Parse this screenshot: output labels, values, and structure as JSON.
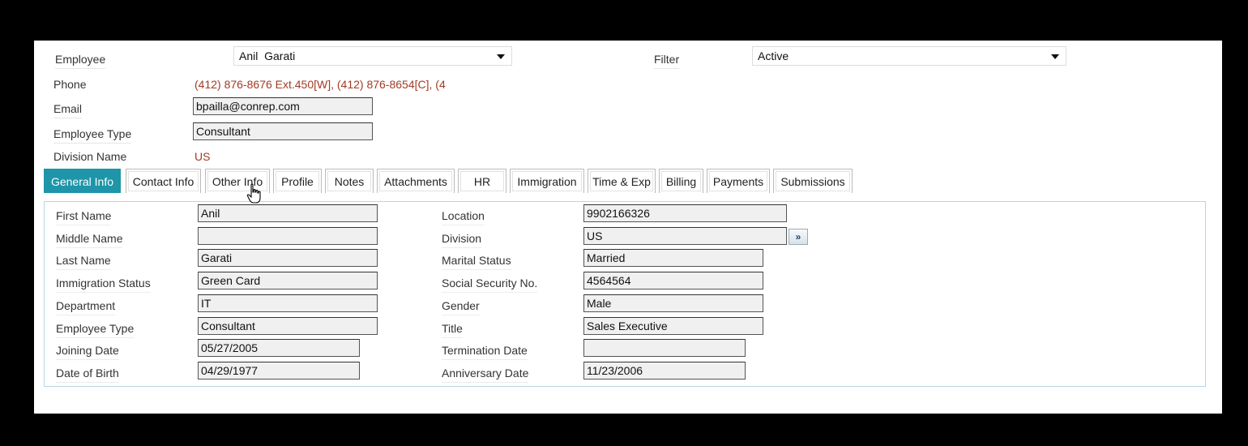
{
  "header": {
    "employee_label": "Employee",
    "employee_value": "Anil  Garati",
    "filter_label": "Filter",
    "filter_value": "Active",
    "phone_label": "Phone",
    "phone_value": "(412) 876-8676 Ext.450[W], (412) 876-8654[C], (4",
    "email_label": "Email",
    "email_value": "bpailla@conrep.com",
    "employee_type_label": "Employee Type",
    "employee_type_value": "Consultant",
    "division_label": "Division Name",
    "division_value": "US"
  },
  "tabs": [
    {
      "label": "General Info",
      "active": true
    },
    {
      "label": "Contact Info"
    },
    {
      "label": "Other Info"
    },
    {
      "label": "Profile"
    },
    {
      "label": "Notes"
    },
    {
      "label": "Attachments"
    },
    {
      "label": "HR"
    },
    {
      "label": "Immigration"
    },
    {
      "label": "Time & Exp"
    },
    {
      "label": "Billing"
    },
    {
      "label": "Payments"
    },
    {
      "label": "Submissions"
    }
  ],
  "general_info": {
    "left": [
      {
        "label": "First Name",
        "value": "Anil"
      },
      {
        "label": "Middle Name",
        "value": ""
      },
      {
        "label": "Last Name",
        "value": "Garati"
      },
      {
        "label": "Immigration Status",
        "value": "Green Card"
      },
      {
        "label": "Department",
        "value": "IT"
      },
      {
        "label": "Employee Type",
        "value": "Consultant"
      },
      {
        "label": "Joining Date",
        "value": "05/27/2005"
      },
      {
        "label": "Date of Birth",
        "value": "04/29/1977"
      }
    ],
    "right": [
      {
        "label": "Location",
        "value": "9902166326"
      },
      {
        "label": "Division",
        "value": "US"
      },
      {
        "label": "Marital Status",
        "value": "Married"
      },
      {
        "label": "Social Security No.",
        "value": "4564564"
      },
      {
        "label": "Gender",
        "value": "Male"
      },
      {
        "label": "Title",
        "value": "Sales Executive"
      },
      {
        "label": "Termination Date",
        "value": ""
      },
      {
        "label": "Anniversary Date",
        "value": "11/23/2006"
      }
    ],
    "division_more_label": "»"
  },
  "colors": {
    "active_tab": "#1e95a8",
    "red_text": "#a33a25",
    "tab_border": "#b9d6e3"
  }
}
